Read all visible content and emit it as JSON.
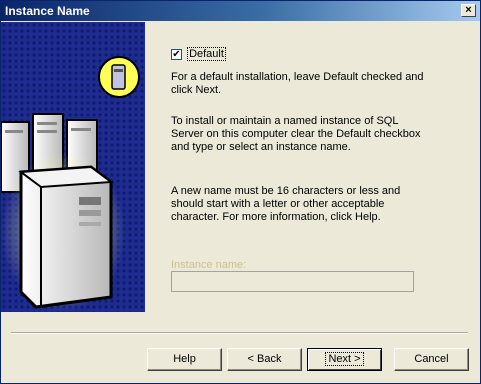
{
  "window": {
    "title": "Instance Name",
    "close_glyph": "×"
  },
  "checkbox": {
    "label": "Default",
    "checked": true,
    "check_glyph": "✔"
  },
  "text": {
    "p1": "For a default installation, leave Default checked and click Next.",
    "p2": "To install or maintain a named instance of SQL Server on this computer clear the Default checkbox and type or select an instance name.",
    "p3": "A new name must be 16 characters or less and should start with a letter or other acceptable character. For more information, click Help."
  },
  "instance": {
    "label": "Instance name:",
    "value": ""
  },
  "buttons": {
    "help": "Help",
    "back": "< Back",
    "next": "Next >",
    "cancel": "Cancel"
  },
  "icons": {
    "illustration": "server-computers-illustration",
    "close": "close-icon"
  },
  "colors": {
    "title_bar": "#0a246a",
    "dialog_bg": "#ece9d8",
    "panel_blue": "#1f2c8f",
    "highlight_yellow": "#ffff66",
    "disabled_label": "#c9c28a"
  }
}
